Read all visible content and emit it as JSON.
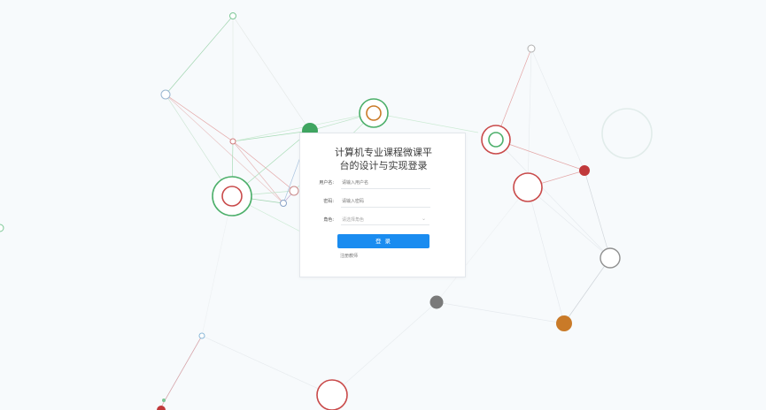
{
  "app": {
    "title_line1": "计算机专业课程微课平",
    "title_line2": "台的设计与实现登录"
  },
  "form": {
    "username_label": "用户名:",
    "username_placeholder": "请输入用户名",
    "password_label": "密码:",
    "password_placeholder": "请输入密码",
    "role_label": "角色:",
    "role_placeholder": "请选择角色",
    "login_label": "登 录",
    "register_label": "注册教师"
  },
  "colors": {
    "background": "#f7fafc",
    "primary_button": "#1a8cf0",
    "node_green": "#4caf6a",
    "node_red": "#c94a4a",
    "node_orange": "#c97a28",
    "node_gray": "#808080",
    "node_blue": "#8ab8d8"
  },
  "icons": {
    "select_arrow": "chevron-down-icon"
  }
}
